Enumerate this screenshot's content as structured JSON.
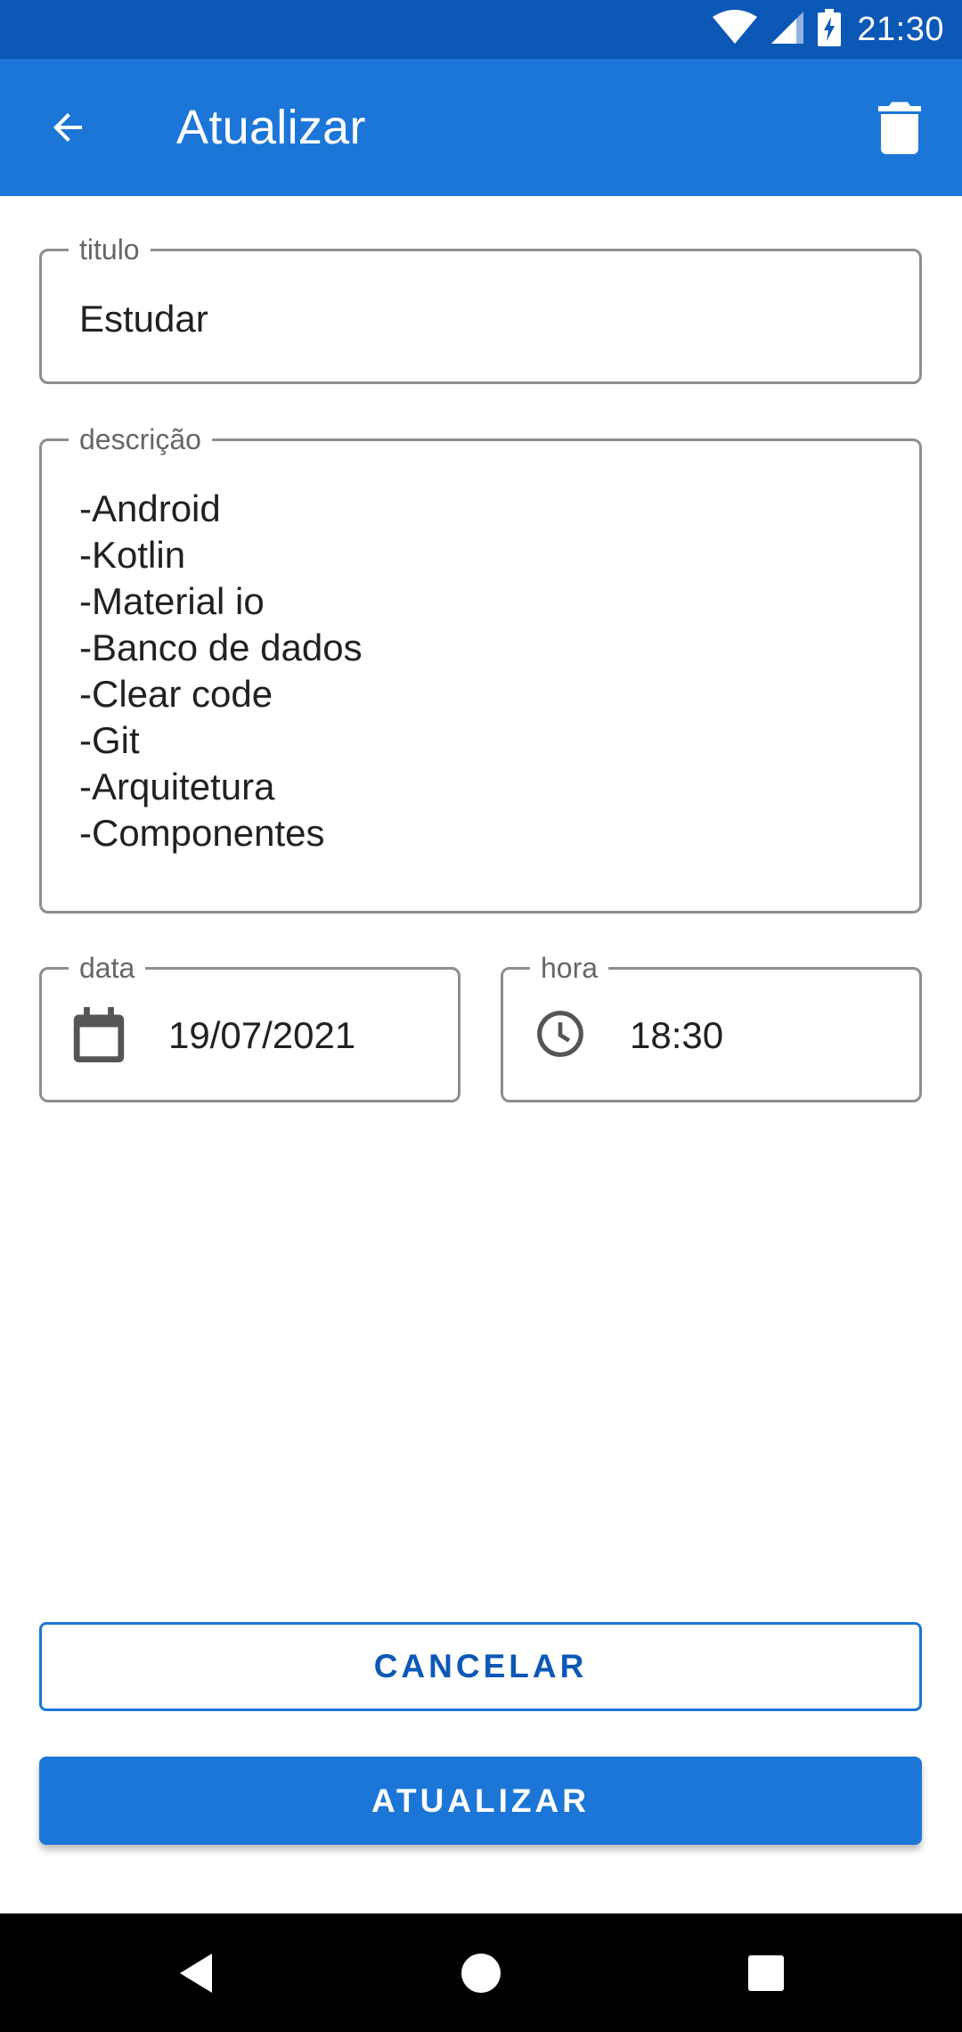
{
  "status_bar": {
    "time": "21:30"
  },
  "app_bar": {
    "title": "Atualizar"
  },
  "form": {
    "title": {
      "label": "titulo",
      "value": "Estudar"
    },
    "description": {
      "label": "descrição",
      "lines": [
        "-Android",
        "-Kotlin",
        "-Material io",
        "-Banco de dados",
        "-Clear code",
        "-Git",
        "-Arquitetura",
        "-Componentes"
      ]
    },
    "date": {
      "label": "data",
      "value": "19/07/2021"
    },
    "time": {
      "label": "hora",
      "value": "18:30"
    }
  },
  "actions": {
    "cancel_label": "CANCELAR",
    "update_label": "ATUALIZAR"
  },
  "colors": {
    "status_bar": "#0b58b7",
    "app_bar": "#1b76d8",
    "primary": "#1b76d8"
  }
}
